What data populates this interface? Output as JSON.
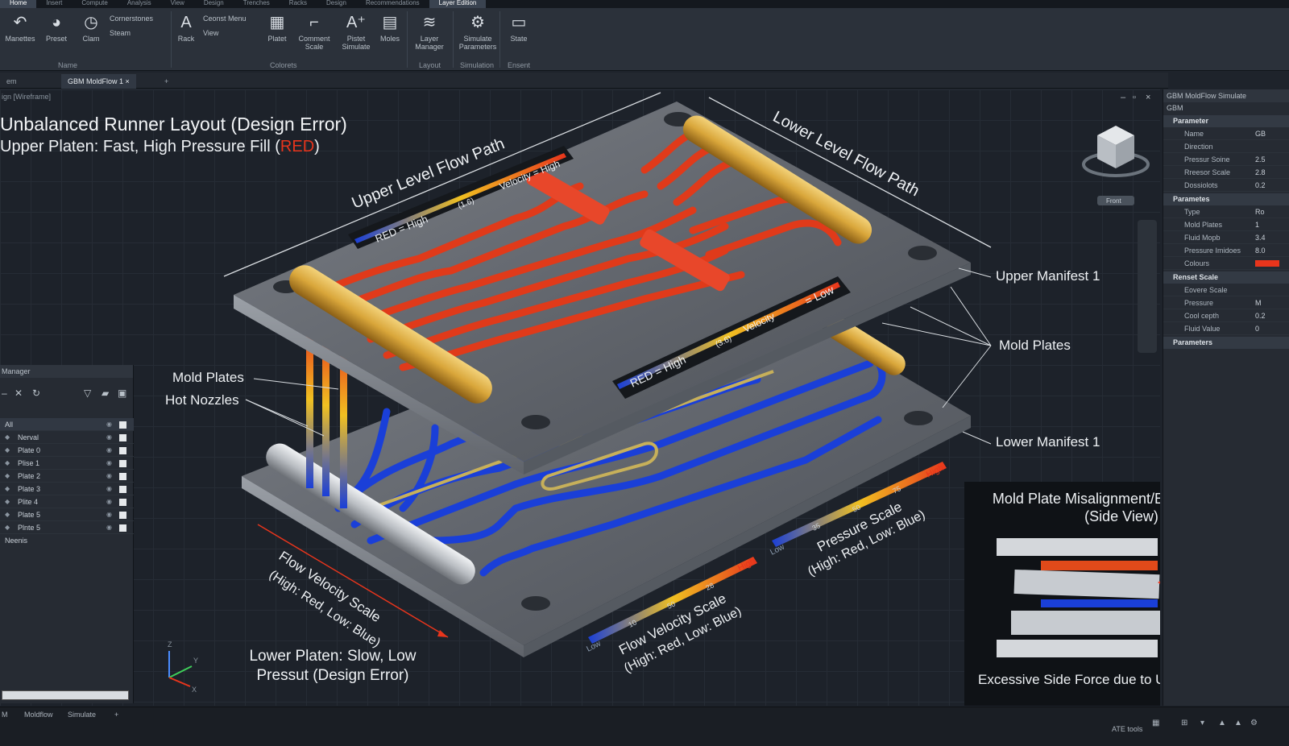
{
  "menu": {
    "tabs": [
      "Home",
      "Insert",
      "Compute",
      "Analysis",
      "View",
      "Design",
      "Trenches",
      "Racks",
      "Design",
      "Recommendations",
      "Layer Edition"
    ],
    "active": 0
  },
  "ribbon": {
    "buttons": [
      {
        "label": "Manettes",
        "icon": "undo-arrow-icon"
      },
      {
        "label": "Preset",
        "icon": "gauge-icon"
      },
      {
        "label": "Clam",
        "icon": "clock-icon"
      },
      {
        "label": "Rack",
        "icon": "text-a-icon"
      },
      {
        "label": "Platet",
        "icon": "table-icon"
      },
      {
        "label": "Comment Scale",
        "icon": "comment-scale-icon"
      },
      {
        "label": "Pistet Simulate",
        "icon": "text-a-plus-icon"
      },
      {
        "label": "Moles",
        "icon": "mold-icon"
      },
      {
        "label": "Layer Manager",
        "icon": "layers-icon"
      },
      {
        "label": "Simulate Parameters",
        "icon": "simulate-icon"
      },
      {
        "label": "State",
        "icon": "folder-icon"
      }
    ],
    "small_buttons": [
      "Cornerstones",
      "Steam",
      "Ceonst Menu",
      "View"
    ],
    "groups": [
      "Name",
      "Colorets",
      "Layout",
      "Simulation",
      "Ensent"
    ]
  },
  "doc_tabs": [
    "em",
    "GBM MoldFlow 1"
  ],
  "viewport": {
    "label": "ign [Wireframe]",
    "title_line1": "Unbalanced Runner Layout (Design Error)",
    "title_line2_prefix": "Upper Platen: Fast, High Pressure Fill (",
    "title_line2_red": "RED",
    "title_line2_suffix": ")",
    "upper_flow_path": "Upper Level Flow Path",
    "lower_flow_path": "Lower Level Flow Path",
    "legend_upper": {
      "high": "RED = High",
      "mid": "(1.6)",
      "velocity": "Velocity = High"
    },
    "legend_lower": {
      "high": "RED = High",
      "mid": "(3.6)",
      "velocity": "Velocity",
      "low": "= Low"
    },
    "callouts": {
      "upper_manifest": "Upper Manifest 1",
      "mold_plates_right": "Mold Plates",
      "mold_plates_left": "Mold Plates",
      "hot_nozzles": "Hot Nozzles",
      "lower_manifest": "Lower Manifest 1"
    },
    "flow_velocity_scale_left": {
      "line1": "Flow Velocity Scale",
      "line2": "(High: Red, Low: Blue)"
    },
    "flow_velocity_scale_bottom": {
      "line1": "Flow Velocity Scale",
      "line2": "(High: Red, Low: Blue)",
      "low": "Low",
      "t1": "10",
      "t2": "50",
      "t3": "28",
      "high": "High"
    },
    "pressure_scale": {
      "line1": "Pressure Scale",
      "line2": "(High: Red, Low: Blue)",
      "low": "Low",
      "t1": "35",
      "t2": "50",
      "t3": "75",
      "high": "High"
    },
    "lower_platen_line1": "Lower Platen: Slow, Low",
    "lower_platen_line2": "Pressut (Design Error)",
    "viewcube_label": "Front",
    "axes": {
      "x": "X",
      "y": "Y",
      "z": "Z"
    }
  },
  "inset": {
    "title_line1": "Mold Plate Misalignment/Eccentric Load",
    "title_line2": "(Side View)",
    "bottom": "Excessive Side Force due to Unbalanced R",
    "side1": "E",
    "side2": "S",
    "side3": "U"
  },
  "layer_manager": {
    "title": "Manager",
    "header": "All",
    "rows": [
      "Nerval",
      "Plate 0",
      "Plise 1",
      "Plate 2",
      "Plate 3",
      "Plite 4",
      "Plate 5",
      "Plnte 5"
    ],
    "footer": "Neenis"
  },
  "properties": {
    "title": "GBM MoldFlow Simulate",
    "subtitle": "GBM",
    "sections": [
      {
        "name": "Parameter",
        "rows": [
          [
            "Name",
            "GB"
          ],
          [
            "Direction",
            ""
          ],
          [
            "Pressur Soine",
            "2.5"
          ],
          [
            "Rreesor Scale",
            "2.8"
          ],
          [
            "Dossiolots",
            "0.2"
          ]
        ]
      },
      {
        "name": "Parametes",
        "rows": [
          [
            "Type",
            "Ro"
          ],
          [
            "Mold Plates",
            "1"
          ],
          [
            "Fluid Mopb",
            "3.4"
          ],
          [
            "Pressure Imidoes",
            "8.0"
          ],
          [
            "Colours",
            ""
          ]
        ]
      },
      {
        "name": "Renset Scale",
        "rows": [
          [
            "Eovere Scale",
            ""
          ],
          [
            "Pressure",
            "M"
          ],
          [
            "Cool cepth",
            "0.2"
          ],
          [
            "Fluid Value",
            "0"
          ]
        ]
      },
      {
        "name": "Parameters",
        "rows": []
      }
    ]
  },
  "status": {
    "tabs": [
      "M",
      "Moldflow",
      "Simulate"
    ],
    "right": "ATE tools"
  },
  "colors": {
    "red": "#e8351c",
    "blue": "#1a3fd8",
    "gold": "#d9a63a"
  }
}
